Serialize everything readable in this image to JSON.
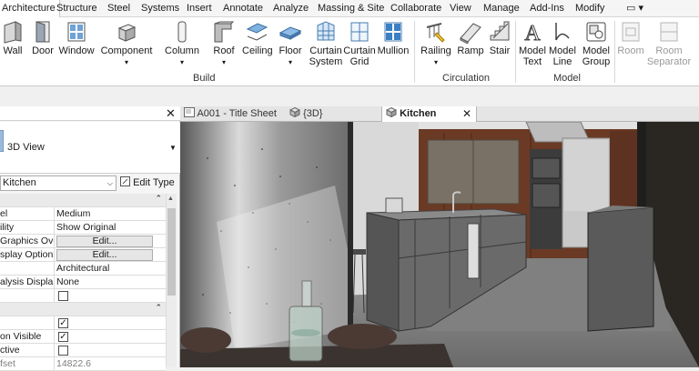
{
  "menu": {
    "tabs": [
      "Architecture",
      "Structure",
      "Steel",
      "Systems",
      "Insert",
      "Annotate",
      "Analyze",
      "Massing & Site",
      "Collaborate",
      "View",
      "Manage",
      "Add-Ins",
      "Modify"
    ],
    "active_tab": "Architecture",
    "extra_control": "▭ ▾"
  },
  "ribbon": {
    "build": {
      "label": "Build",
      "tools": [
        "Wall",
        "Door",
        "Window",
        "Component",
        "Column",
        "Roof",
        "Ceiling",
        "Floor",
        "Curtain System",
        "Curtain Grid",
        "Mullion"
      ]
    },
    "circulation": {
      "label": "Circulation",
      "tools": [
        "Railing",
        "Ramp",
        "Stair"
      ]
    },
    "model": {
      "label": "Model",
      "tools": [
        "Model Text",
        "Model Line",
        "Model Group"
      ]
    },
    "room": {
      "tools": [
        "Room",
        "Room Separator"
      ]
    }
  },
  "properties": {
    "type_name": "3D View",
    "instance": "Kitchen",
    "edit_type": "Edit Type",
    "rows": [
      {
        "key": "el",
        "value": "Medium"
      },
      {
        "key": "ility",
        "value": "Show Original"
      },
      {
        "key": "Graphics Ove...",
        "value": "Edit..."
      },
      {
        "key": "splay Options",
        "value": "Edit..."
      },
      {
        "key": "",
        "value": "Architectural"
      },
      {
        "key": "alysis Displa...",
        "value": "None"
      },
      {
        "key": "",
        "value": ""
      },
      {
        "key": "",
        "value": ""
      },
      {
        "key": "on Visible",
        "value": ""
      },
      {
        "key": "ctive",
        "value": ""
      },
      {
        "key": "fset",
        "value": "14822.6"
      }
    ]
  },
  "view_tabs": [
    {
      "label": "A001 - Title Sheet",
      "icon": "sheet-icon"
    },
    {
      "label": "{3D}",
      "icon": "cube-icon"
    },
    {
      "label": "Kitchen",
      "icon": "cube-icon",
      "active": true
    }
  ],
  "colors": {
    "ribbon_bg": "#ffffff",
    "panel_bg": "#f5f5f5",
    "ribbon_icon_blue": "#3b7fc4"
  }
}
